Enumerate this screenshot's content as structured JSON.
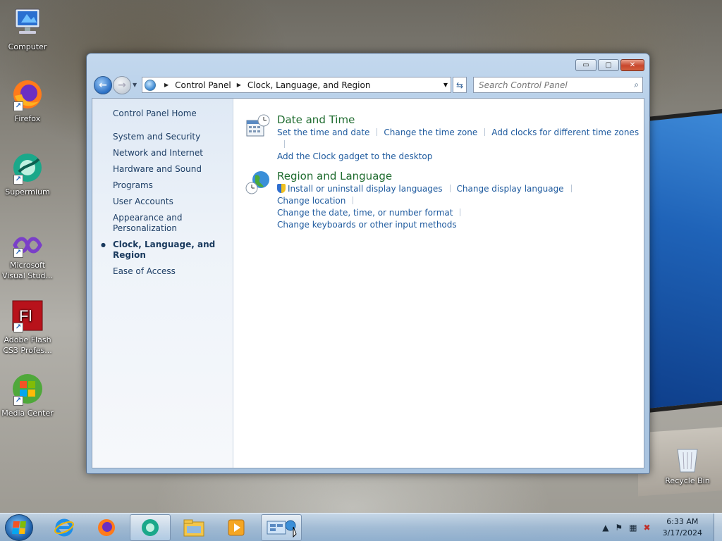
{
  "desktop": {
    "icons": [
      {
        "label": "Computer"
      },
      {
        "label": "Firefox"
      },
      {
        "label": "Supermium"
      },
      {
        "label": "Microsoft Visual Stud..."
      },
      {
        "label": "Adobe Flash CS3 Profes..."
      },
      {
        "label": "Media Center"
      }
    ],
    "recycle_bin": "Recycle Bin"
  },
  "window": {
    "buttons": {
      "minimize": "▭",
      "maximize": "▢",
      "close": "✕"
    },
    "address": {
      "crumbs": [
        "Control Panel",
        "Clock, Language, and Region"
      ]
    },
    "search_placeholder": "Search Control Panel",
    "sidebar": {
      "home": "Control Panel Home",
      "items": [
        {
          "label": "System and Security"
        },
        {
          "label": "Network and Internet"
        },
        {
          "label": "Hardware and Sound"
        },
        {
          "label": "Programs"
        },
        {
          "label": "User Accounts"
        },
        {
          "label": "Appearance and Personalization"
        },
        {
          "label": "Clock, Language, and Region",
          "active": true
        },
        {
          "label": "Ease of Access"
        }
      ]
    },
    "categories": [
      {
        "title": "Date and Time",
        "links": [
          "Set the time and date",
          "Change the time zone",
          "Add clocks for different time zones",
          "Add the Clock gadget to the desktop"
        ]
      },
      {
        "title": "Region and Language",
        "links": [
          "Install or uninstall display languages",
          "Change display language",
          "Change location",
          "Change the date, time, or number format",
          "Change keyboards or other input methods"
        ]
      }
    ]
  },
  "taskbar": {
    "clock_time": "6:33 AM",
    "clock_date": "3/17/2024"
  },
  "colors": {
    "link": "#1e5a9e",
    "category_title": "#1e6b2e",
    "sidebar_text": "#1e3f66"
  }
}
